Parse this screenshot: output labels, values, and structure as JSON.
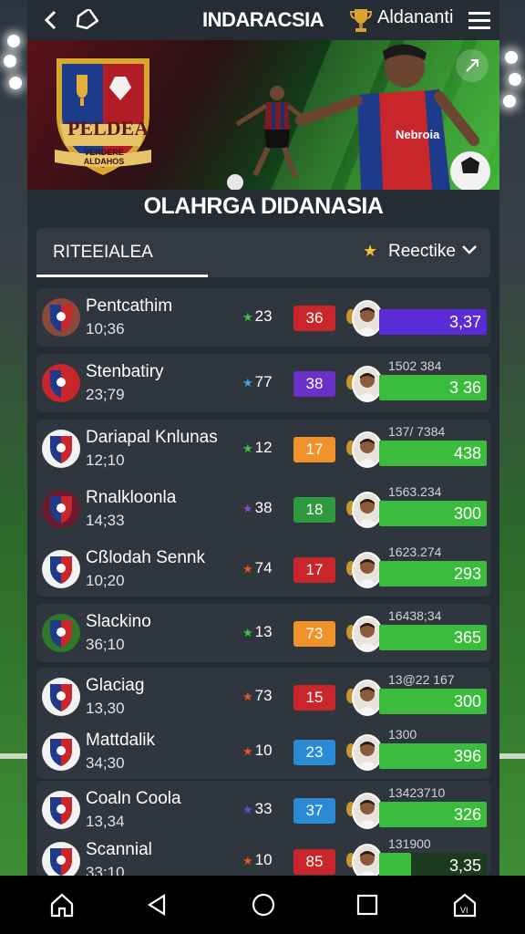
{
  "header": {
    "app_title": "INDARACSIA",
    "user_name": "Aldananti",
    "icons": [
      "back-icon",
      "tag-icon",
      "trophy-icon",
      "menu-icon"
    ]
  },
  "banner": {
    "crest_title": "PELDEA",
    "crest_subtitle": "VERDERE ALDAHOS",
    "jersey_text": "Nebroia",
    "icons": [
      "share-icon"
    ]
  },
  "section_title": "OLAHRGA DIDANASIA",
  "filter": {
    "label": "RITEEIALEA",
    "sort_label": "Reectike",
    "icons": [
      "star-icon",
      "chevron-down-icon"
    ]
  },
  "matches": [
    {
      "name": "Pentcathim",
      "time": "10;36",
      "rating": "23",
      "star_color": "#3cc24a",
      "score": "36",
      "score_color": "#c8262a",
      "bar_caption": "",
      "bar_value": "3,37",
      "bar_fill": 1.0,
      "bar_color": "#5a2bd6"
    },
    {
      "name": "Stenbatiry",
      "time": "23;79",
      "rating": "77",
      "star_color": "#3aa6e6",
      "score": "38",
      "score_color": "#6a30c8",
      "bar_caption": "1502 384",
      "bar_value": "3 36",
      "bar_fill": 1.0,
      "bar_color": "#3cbc3c"
    },
    {
      "name": "Dariapal Knlunas",
      "time": "12;10",
      "rating": "12",
      "star_color": "#3cc24a",
      "score": "17",
      "score_color": "#f0922a",
      "bar_caption": "137/ 7384",
      "bar_value": "438",
      "bar_fill": 1.0,
      "bar_color": "#3cbc3c"
    },
    {
      "name": "Rnalkloonla",
      "time": "14;33",
      "rating": "38",
      "star_color": "#8a4ad8",
      "score": "18",
      "score_color": "#2e9a3e",
      "bar_caption": "1563.234",
      "bar_value": "300",
      "bar_fill": 1.0,
      "bar_color": "#3cbc3c"
    },
    {
      "name": "Cßlodah Sennk",
      "time": "10;20",
      "rating": "74",
      "star_color": "#e8552a",
      "score": "17",
      "score_color": "#c8262a",
      "bar_caption": "1623.274",
      "bar_value": "293",
      "bar_fill": 1.0,
      "bar_color": "#3cbc3c"
    },
    {
      "name": "Slackino",
      "time": "36;10",
      "rating": "13",
      "star_color": "#3cc24a",
      "score": "73",
      "score_color": "#f0922a",
      "bar_caption": "16438;34",
      "bar_value": "365",
      "bar_fill": 1.0,
      "bar_color": "#3cbc3c"
    },
    {
      "name": "Glaciag",
      "time": "13,30",
      "rating": "73",
      "star_color": "#e8552a",
      "score": "15",
      "score_color": "#c8262a",
      "bar_caption": "13@22 167",
      "bar_value": "300",
      "bar_fill": 1.0,
      "bar_color": "#3cbc3c"
    },
    {
      "name": "Mattdalik",
      "time": "34;30",
      "rating": "10",
      "star_color": "#e8552a",
      "score": "23",
      "score_color": "#2a8ad6",
      "bar_caption": "1300",
      "bar_value": "396",
      "bar_fill": 1.0,
      "bar_color": "#3cbc3c"
    },
    {
      "name": "Coaln Coola",
      "time": "13,34",
      "rating": "33",
      "star_color": "#6a4ad8",
      "score": "37",
      "score_color": "#2a8ad6",
      "bar_caption": "13423710",
      "bar_value": "326",
      "bar_fill": 1.0,
      "bar_color": "#3cbc3c"
    },
    {
      "name": "Scannial",
      "time": "33;10",
      "rating": "10",
      "star_color": "#e8552a",
      "score": "85",
      "score_color": "#c8262a",
      "bar_caption": "131900",
      "bar_value": "3,35",
      "bar_fill": 0.3,
      "bar_color": "#3cbc3c"
    }
  ],
  "navbar": {
    "icons": [
      "home-icon",
      "back-triangle-icon",
      "circle-home-icon",
      "square-recents-icon",
      "home-vi-icon"
    ]
  }
}
